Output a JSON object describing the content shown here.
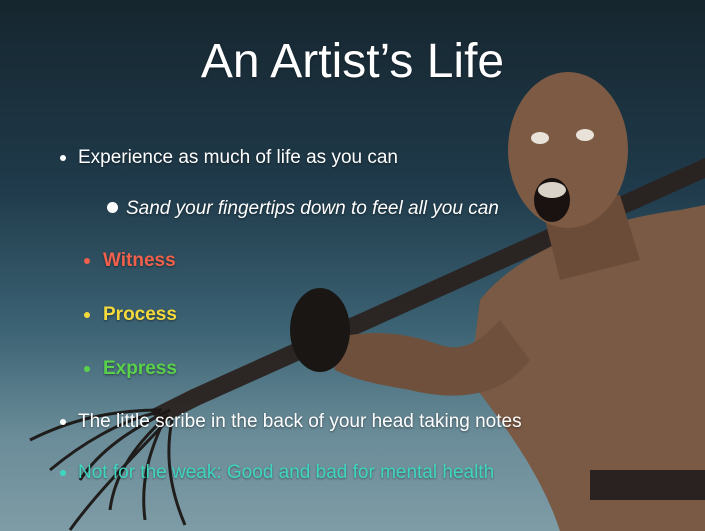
{
  "slide": {
    "title": "An Artist’s Life",
    "bullets": [
      {
        "text": "Experience as much of life as you can",
        "color": "#ffffff"
      },
      {
        "text": "Sand your fingertips down to feel all you can",
        "color": "#ffffff"
      },
      {
        "text": "Witness",
        "color": "#f0604a"
      },
      {
        "text": "Process",
        "color": "#f4da3c"
      },
      {
        "text": "Express",
        "color": "#5ad14a"
      },
      {
        "text": "The little scribe in the back of your head taking notes",
        "color": "#ffffff"
      },
      {
        "text": "Not for the weak: Good and bad for mental health",
        "color": "#3fd6c0"
      }
    ]
  }
}
